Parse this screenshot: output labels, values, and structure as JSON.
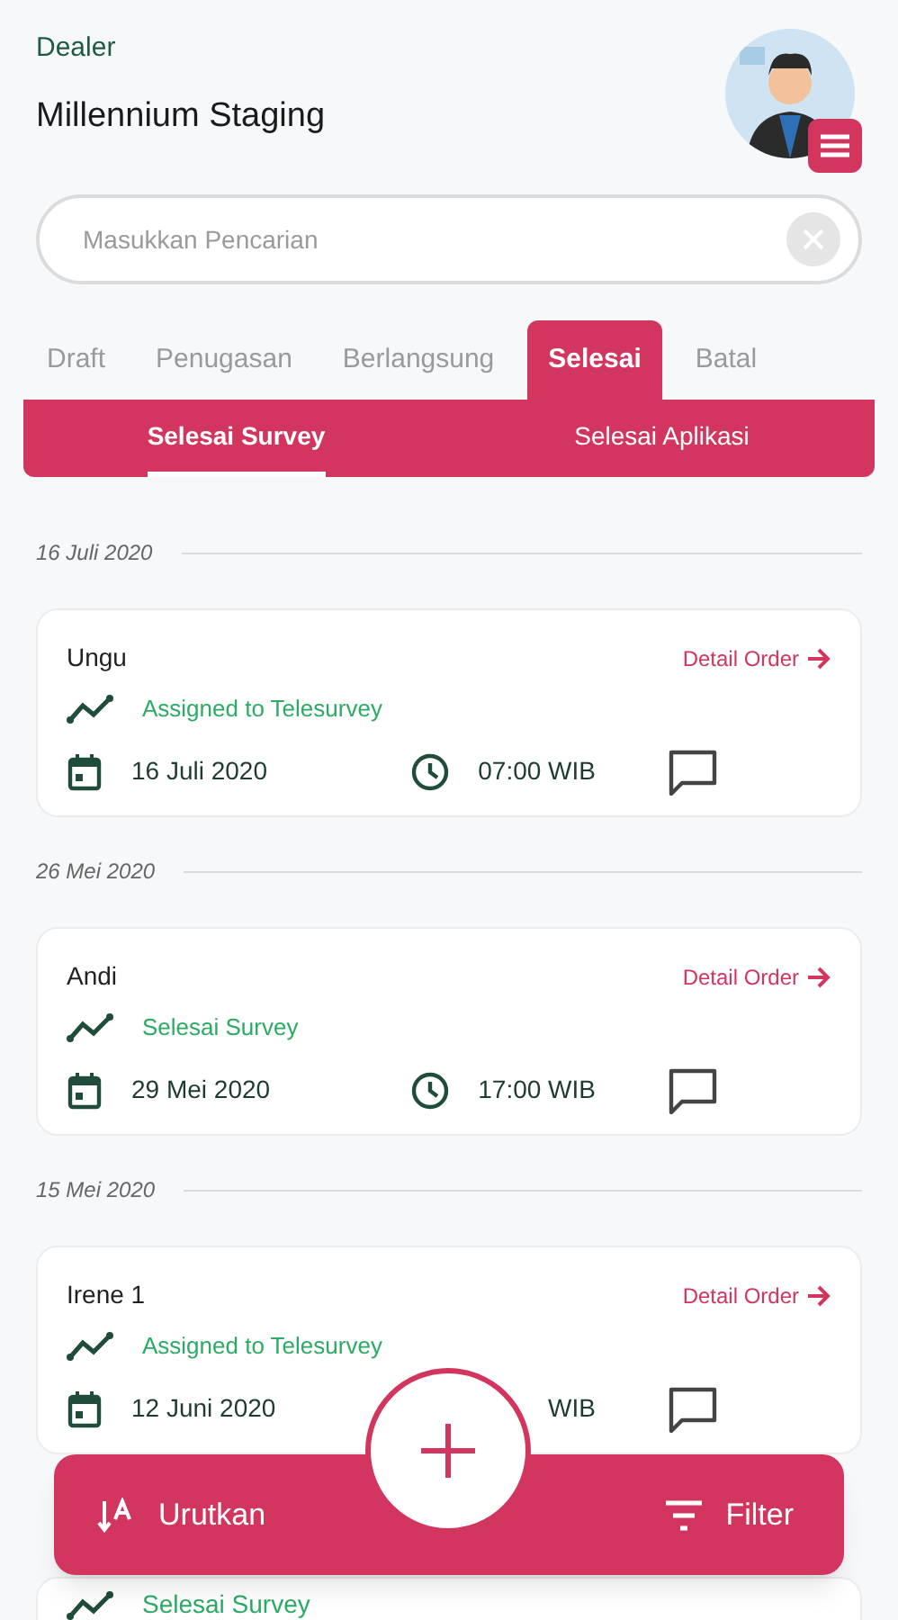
{
  "header": {
    "label": "Dealer",
    "title": "Millennium Staging"
  },
  "search": {
    "placeholder": "Masukkan Pencarian"
  },
  "tabs": [
    {
      "label": "Draft",
      "selected": false
    },
    {
      "label": "Penugasan",
      "selected": false
    },
    {
      "label": "Berlangsung",
      "selected": false
    },
    {
      "label": "Selesai",
      "selected": true
    },
    {
      "label": "Batal",
      "selected": false
    }
  ],
  "subtabs": [
    {
      "label": "Selesai Survey",
      "selected": true
    },
    {
      "label": "Selesai Aplikasi",
      "selected": false
    }
  ],
  "groups": [
    {
      "date": "16 Juli 2020",
      "cards": [
        {
          "name": "Ungu",
          "link": "Detail Order",
          "status": "Assigned to Telesurvey",
          "date": "16 Juli 2020",
          "time": "07:00 WIB",
          "clock_icon": true
        }
      ]
    },
    {
      "date": "26 Mei 2020",
      "cards": [
        {
          "name": "Andi",
          "link": "Detail Order",
          "status": "Selesai Survey",
          "date": "29 Mei 2020",
          "time": "17:00 WIB",
          "clock_icon": true
        }
      ]
    },
    {
      "date": "15 Mei 2020",
      "cards": [
        {
          "name": "Irene 1",
          "link": "Detail Order",
          "status": "Assigned to Telesurvey",
          "date": "12 Juni 2020",
          "time": "WIB",
          "clock_icon": false
        },
        {
          "status": "Selesai Survey"
        }
      ]
    }
  ],
  "bottom_bar": {
    "sort": "Urutkan",
    "filter": "Filter"
  }
}
